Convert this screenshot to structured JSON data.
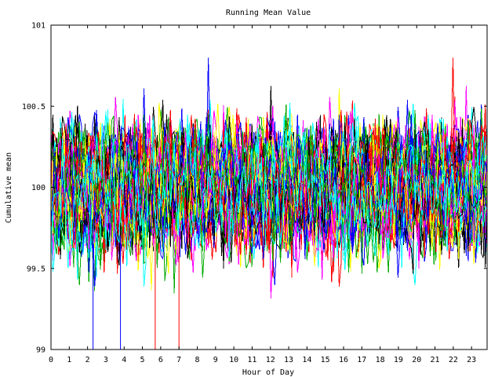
{
  "chart_data": {
    "type": "line",
    "title": "Running Mean Value",
    "xlabel": "Hour of Day",
    "ylabel": "Cumulative mean",
    "xlim": [
      0,
      23.85
    ],
    "ylim": [
      99,
      101
    ],
    "x_ticks": [
      "0",
      "1",
      "2",
      "3",
      "4",
      "5",
      "6",
      "7",
      "8",
      "9",
      "10",
      "11",
      "12",
      "13",
      "14",
      "15",
      "16",
      "17",
      "18",
      "19",
      "20",
      "21",
      "22",
      "23"
    ],
    "y_ticks": [
      "99",
      "99.5",
      "100",
      "100.5",
      "101"
    ],
    "series_count": 60,
    "colors": [
      "#0000ff",
      "#ff0000",
      "#00aa00",
      "#00ffff",
      "#ff00ff",
      "#ffff00",
      "#000000"
    ],
    "value_range": {
      "center": 100,
      "typical_min": 99.55,
      "typical_max": 100.5,
      "extreme_min": 99.15,
      "extreme_max": 100.82
    },
    "notable_drops": [
      {
        "x": 2.3,
        "y": 99,
        "color": "#0000ff"
      },
      {
        "x": 3.8,
        "y": 99,
        "color": "#0000ff"
      },
      {
        "x": 5.7,
        "y": 99,
        "color": "#ff0000"
      },
      {
        "x": 7.0,
        "y": 99,
        "color": "#ff0000"
      }
    ]
  }
}
